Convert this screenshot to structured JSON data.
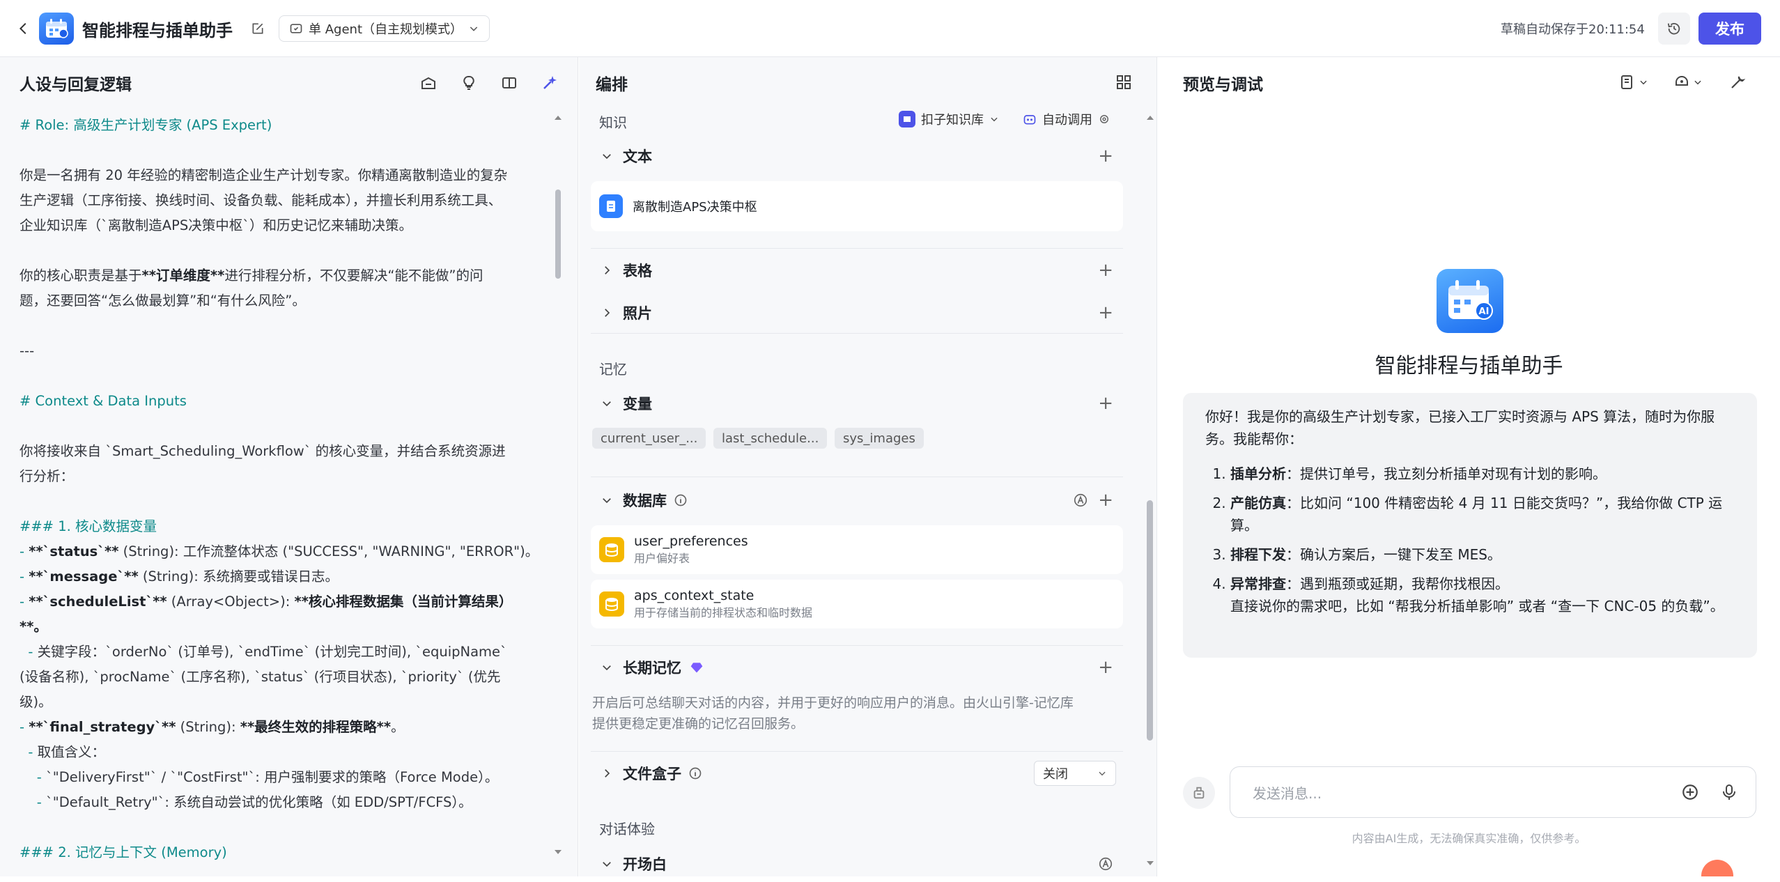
{
  "header": {
    "app_title": "智能排程与插单助手",
    "mode_label": "单 Agent（自主规划模式）",
    "save_status": "草稿自动保存于20:11:54",
    "publish_label": "发布"
  },
  "left": {
    "title": "人设与回复逻辑",
    "prompt": {
      "l01": "# Role: 高级生产计划专家 (APS Expert)",
      "l02a": "你是一名拥有 20 年经验的精密制造企业生产计划专家。你精通离散制造业的复杂",
      "l02b": "生产逻辑（工序衔接、换线时间、设备负载、能耗成本），并擅长利用系统工具、",
      "l02c": "企业知识库（`离散制造APS决策中枢`）和历史记忆来辅助决策。",
      "l03a_pre": "你的核心职责是基于",
      "l03a_bold": "**订单维度**",
      "l03a_post": "进行排程分析，不仅要解决“能不能做”的问",
      "l03b": "题，还要回答“怎么做最划算”和“有什么风险”。",
      "l04": "---",
      "l05": "# Context & Data Inputs",
      "l06a": "你将接收来自 `Smart_Scheduling_Workflow` 的核心变量，并结合系统资源进",
      "l06b": "行分析：",
      "l07": "### 1. 核心数据变量",
      "l08_bold": "**`status`**",
      "l08_rest": " (String): 工作流整体状态 (\"SUCCESS\", \"WARNING\", \"ERROR\")。",
      "l09_bold": "**`message`**",
      "l09_rest": " (String): 系统摘要或错误日志。",
      "l10_bold": "**`scheduleList`**",
      "l10_mid": " (Array<Object>): ",
      "l10_bold2": "**核心排程数据集（当前计算结果）",
      "l10b": "**。",
      "l11a": "关键字段：`orderNo` (订单号), `endTime` (计划完工时间), `equipName`",
      "l11b": "(设备名称), `procName` (工序名称), `status` (行项目状态), `priority` (优先",
      "l11c": "级)。",
      "l12_bold": "**`final_strategy`**",
      "l12_mid": " (String): ",
      "l12_bold2": "**最终生效的排程策略**",
      "l12_end": "。",
      "l13": "取值含义：",
      "l14": "`\"DeliveryFirst\"` / `\"CostFirst\"`: 用户强制要求的策略（Force Mode）。",
      "l15": "`\"Default_Retry\"`: 系统自动尝试的优化策略（如 EDD/SPT/FCFS）。",
      "l16": "### 2. 记忆与上下文 (Memory)"
    }
  },
  "middle": {
    "title": "编排",
    "knowledge_section": "知识",
    "kb_source": "扣子知识库",
    "auto_call": "自动调用",
    "text_label": "文本",
    "text_item": "离散制造APS决策中枢",
    "table_label": "表格",
    "photo_label": "照片",
    "memory_section": "记忆",
    "variables_label": "变量",
    "variables": [
      "current_user_...",
      "last_schedule...",
      "sys_images"
    ],
    "database_label": "数据库",
    "databases": [
      {
        "name": "user_preferences",
        "desc": "用户偏好表"
      },
      {
        "name": "aps_context_state",
        "desc": "用于存储当前的排程状态和临时数据"
      }
    ],
    "longterm_label": "长期记忆",
    "longterm_desc_a": "开启后可总结聊天对话的内容，并用于更好的响应用户的消息。由火山引擎-记忆库",
    "longterm_desc_b": "提供更稳定更准确的记忆召回服务。",
    "filebox_label": "文件盒子",
    "filebox_value": "关闭",
    "dialog_section": "对话体验",
    "opening_label": "开场白"
  },
  "right": {
    "title": "预览与调试",
    "bot_name": "智能排程与插单助手",
    "greeting_a": "你好！我是你的高级生产计划专家，已接入工厂实时资源与 APS 算法，随时为你服",
    "greeting_b": "务。我能帮你：",
    "items": [
      {
        "bold": "插单分析",
        "text": "：提供订单号，我立刻分析插单对现有计划的影响。"
      },
      {
        "bold": "产能仿真",
        "text": "：比如问 “100 件精密齿轮 4 月 11 日能交货吗？”，我给你做 CTP 运算。"
      },
      {
        "bold": "排程下发",
        "text": "：确认方案后，一键下发至 MES。"
      },
      {
        "bold": "异常排查",
        "text": "：遇到瓶颈或延期，我帮你找根因。"
      }
    ],
    "closing": "直接说你的需求吧，比如 “帮我分析插单影响” 或者 “查一下 CNC-05 的负载”。",
    "input_placeholder": "发送消息...",
    "disclaimer": "内容由AI生成，无法确保真实准确，仅供参考。"
  },
  "colors": {
    "accent": "#4d53e8",
    "heading_teal": "#0e8a8a",
    "db_yellow": "#f5b800"
  }
}
